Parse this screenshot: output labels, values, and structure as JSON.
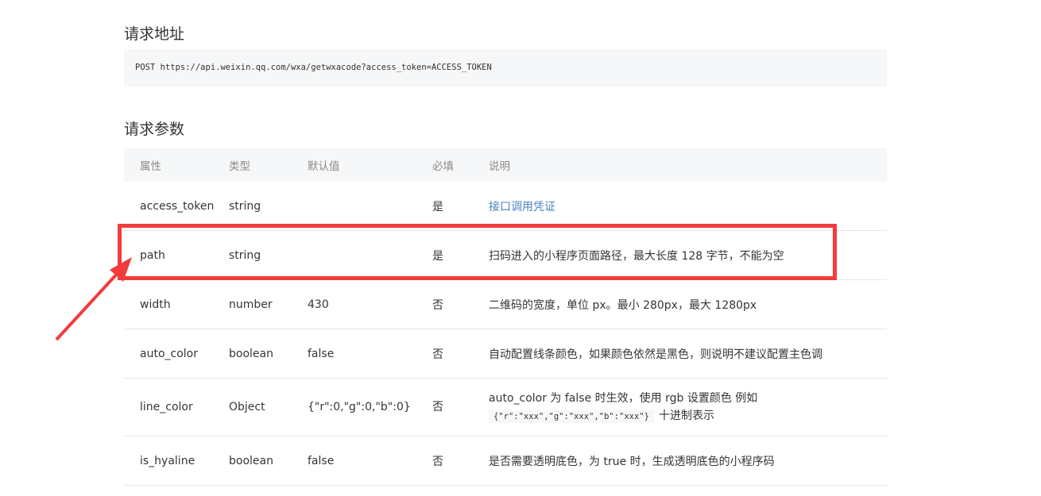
{
  "request_url": {
    "heading": "请求地址",
    "code": "POST https://api.weixin.qq.com/wxa/getwxacode?access_token=ACCESS_TOKEN"
  },
  "request_params": {
    "heading": "请求参数",
    "columns": [
      "属性",
      "类型",
      "默认值",
      "必填",
      "说明"
    ],
    "rows": [
      {
        "name": "access_token",
        "type": "string",
        "default": "",
        "required": "是",
        "desc": "接口调用凭证"
      },
      {
        "name": "path",
        "type": "string",
        "default": "",
        "required": "是",
        "desc": "扫码进入的小程序页面路径，最大长度 128 字节，不能为空"
      },
      {
        "name": "width",
        "type": "number",
        "default": "430",
        "required": "否",
        "desc": "二维码的宽度，单位 px。最小 280px，最大 1280px"
      },
      {
        "name": "auto_color",
        "type": "boolean",
        "default": "false",
        "required": "否",
        "desc": "自动配置线条颜色，如果颜色依然是黑色，则说明不建议配置主色调"
      },
      {
        "name": "line_color",
        "type": "Object",
        "default": "{\"r\":0,\"g\":0,\"b\":0}",
        "required": "否",
        "desc": "auto_color 为 false 时生效，使用 rgb 设置颜色 例如",
        "desc_code": "{\"r\":\"xxx\",\"g\":\"xxx\",\"b\":\"xxx\"}",
        "desc_tail": "十进制表示"
      },
      {
        "name": "is_hyaline",
        "type": "boolean",
        "default": "false",
        "required": "否",
        "desc": "是否需要透明底色，为 true 时，生成透明底色的小程序码"
      }
    ]
  },
  "annotation_color": "#f23b3b"
}
